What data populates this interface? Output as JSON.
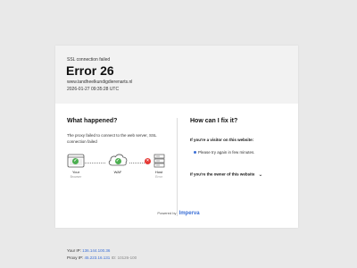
{
  "header": {
    "subtitle": "SSL connection failed",
    "error_code": "Error 26",
    "host": "www.tandheelkundigdierenarts.nl",
    "timestamp": "2026-01-27 09:35:28 UTC"
  },
  "what_happened": {
    "title": "What happened?",
    "description": "The proxy failed to connect to the web server, SSL connection failed",
    "nodes": [
      {
        "label": "Your",
        "status": "Browser",
        "icon": "browser-icon",
        "badge": "check",
        "badge_color": "#4caf50"
      },
      {
        "label": "WAF",
        "status": "",
        "icon": "cloud-icon",
        "badge": "check",
        "badge_color": "#4caf50"
      },
      {
        "label": "Host",
        "status": "Error",
        "icon": "server-icon",
        "badge": "cross",
        "badge_color": "#e53935"
      }
    ],
    "your_ip_label": "Your IP:",
    "your_ip": "136.144.100.36",
    "proxy_ip_label": "Proxy IP:",
    "proxy_ip": "45.223.16.131",
    "proxy_id": "ID: 10126-100"
  },
  "fix": {
    "title": "How can I fix it?",
    "visitor_heading": "If you're a visitor on this website:",
    "visitor_tip": "Please try again in few minutes.",
    "owner_heading": "If you're the owner of this website"
  },
  "footer": {
    "powered_by": "Powered by",
    "brand": "Imperva"
  },
  "colors": {
    "accent": "#3b6fd6",
    "success": "#4caf50",
    "error": "#e53935"
  }
}
